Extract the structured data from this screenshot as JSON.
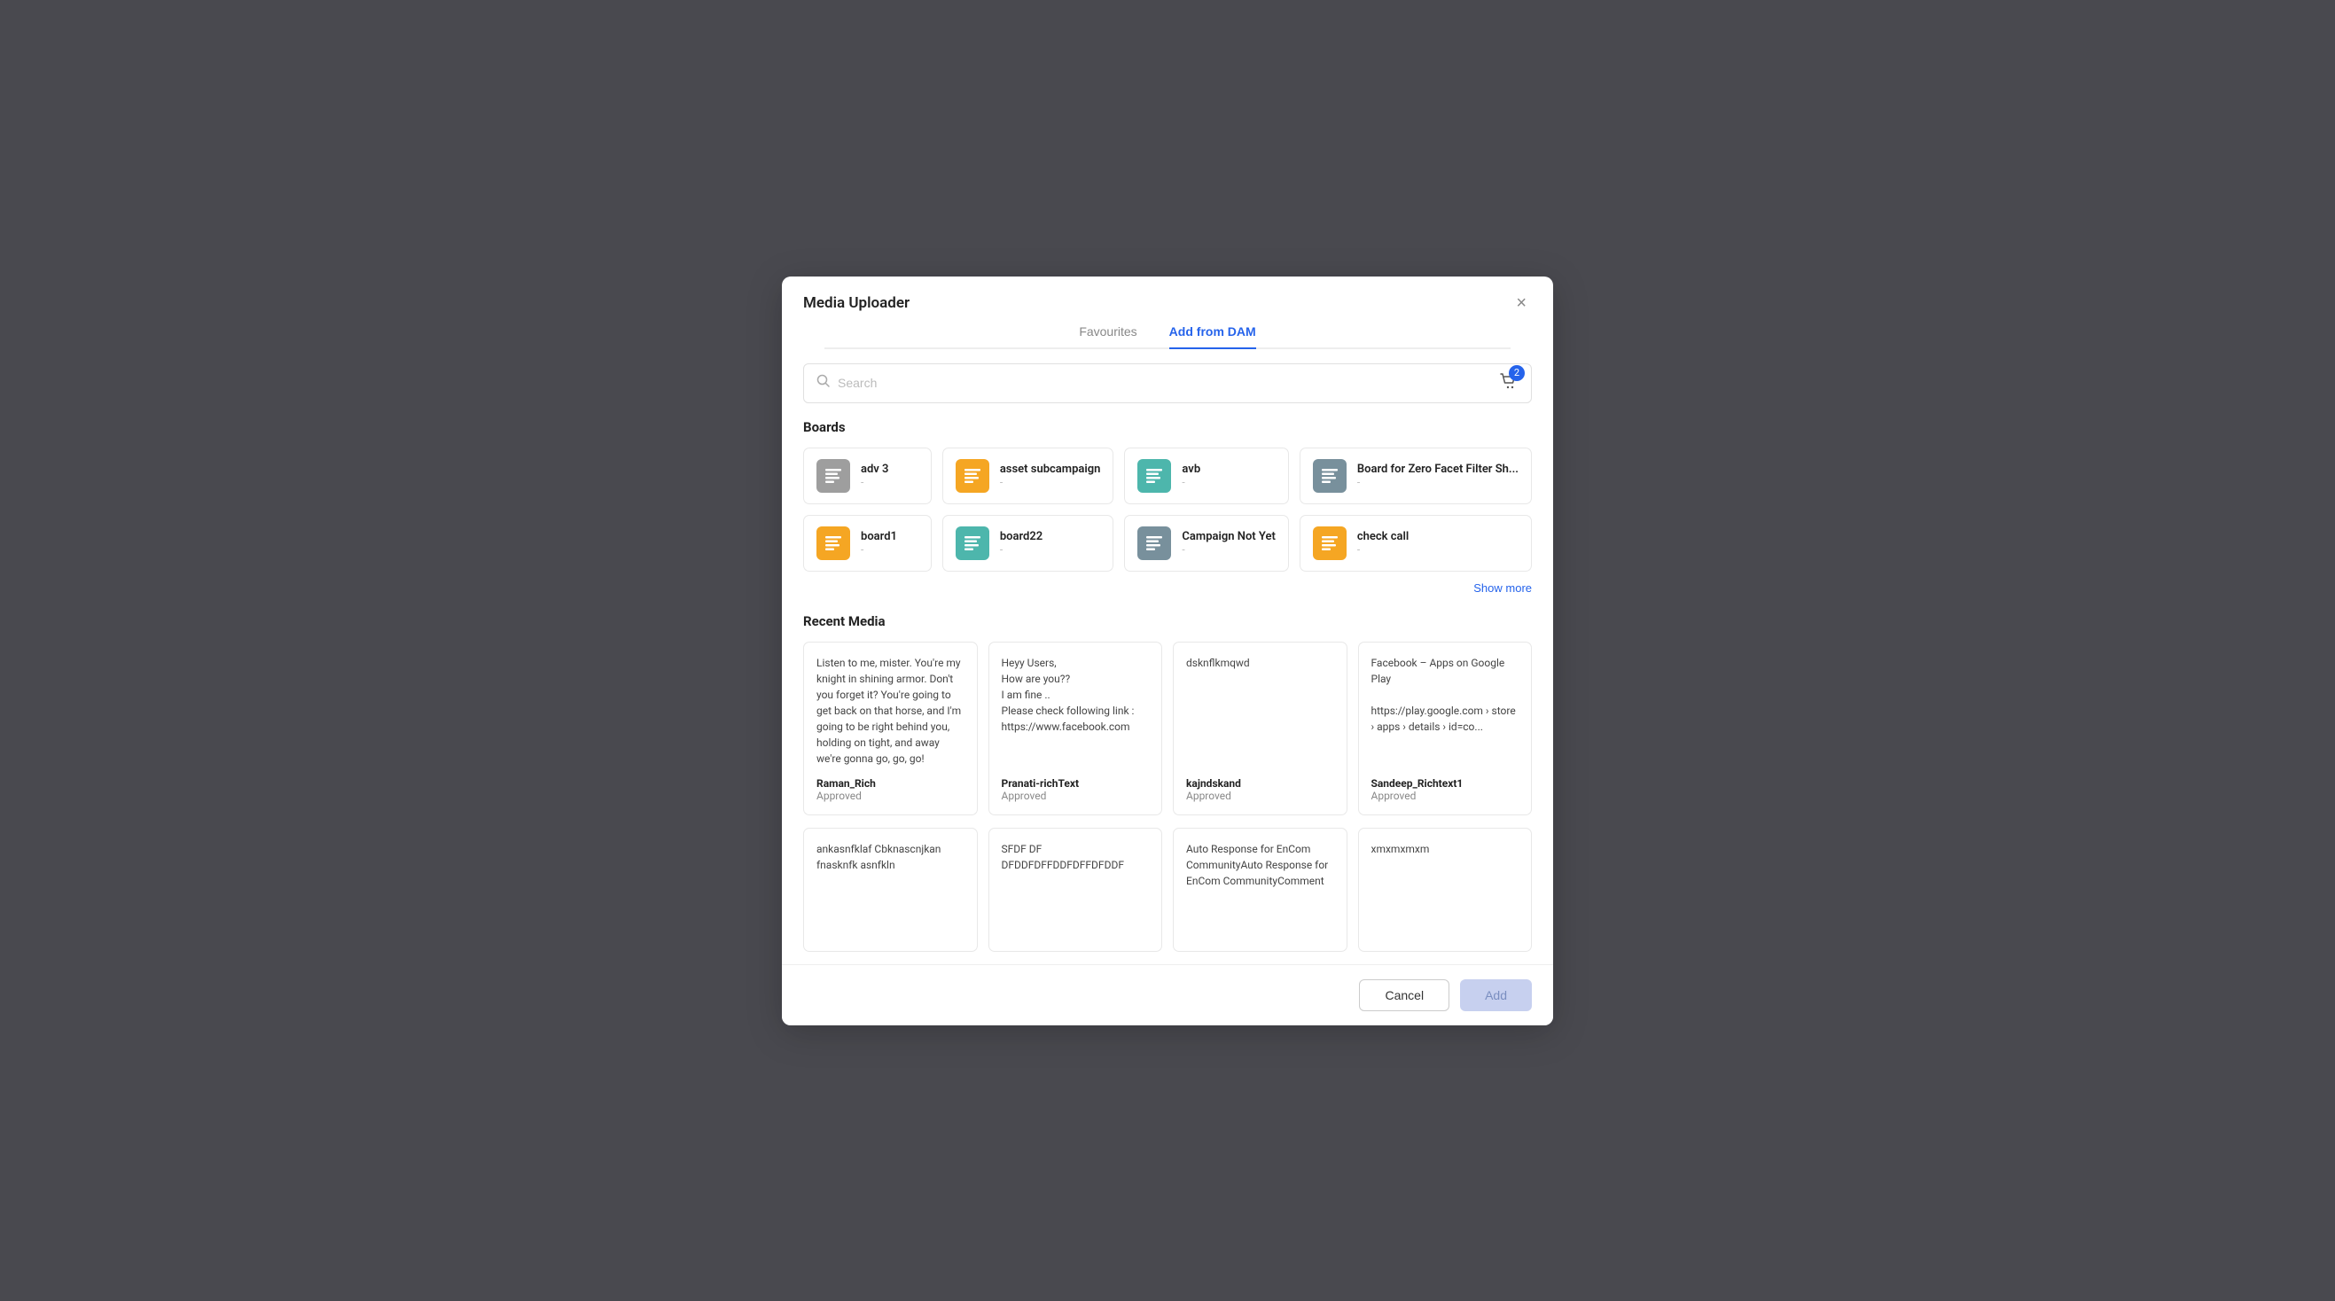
{
  "modal": {
    "title": "Media Uploader",
    "close_label": "×",
    "tabs": [
      {
        "id": "favourites",
        "label": "Favourites",
        "active": false
      },
      {
        "id": "add-from-dam",
        "label": "Add from DAM",
        "active": true
      }
    ],
    "search": {
      "placeholder": "Search"
    },
    "cart_badge": "2",
    "boards_title": "Boards",
    "boards": [
      {
        "id": "adv3",
        "name": "adv 3",
        "sub": "-",
        "color": "gray"
      },
      {
        "id": "asset-subcampaign",
        "name": "asset subcampaign",
        "sub": "-",
        "color": "yellow"
      },
      {
        "id": "avb",
        "name": "avb",
        "sub": "-",
        "color": "teal"
      },
      {
        "id": "board-zero",
        "name": "Board for Zero Facet Filter Sh...",
        "sub": "-",
        "color": "dark"
      },
      {
        "id": "board1",
        "name": "board1",
        "sub": "-",
        "color": "yellow"
      },
      {
        "id": "board22",
        "name": "board22",
        "sub": "-",
        "color": "teal"
      },
      {
        "id": "campaign-not-yet",
        "name": "Campaign Not Yet",
        "sub": "-",
        "color": "dark"
      },
      {
        "id": "check-call",
        "name": "check call",
        "sub": "-",
        "color": "yellow"
      }
    ],
    "show_more_label": "Show more",
    "recent_media_title": "Recent Media",
    "recent_media": [
      {
        "id": "rm1",
        "text": "Listen to me, mister. You're my knight in shining armor. Don't you forget it? You're going to get back on that horse, and I'm going to be right behind you, holding on tight, and away we're gonna go, go, go!",
        "name": "Raman_Rich",
        "status": "Approved"
      },
      {
        "id": "rm2",
        "text": "Heyy Users,\nHow are you??\nI am fine ..\nPlease check following link :\nhttps://www.facebook.com",
        "name": "Pranati-richText",
        "status": "Approved"
      },
      {
        "id": "rm3",
        "text": "dsknflkmqwd",
        "name": "kajndskand",
        "status": "Approved"
      },
      {
        "id": "rm4",
        "text": "Facebook – Apps on Google Play\n\nhttps://play.google.com › store › apps › details › id=co...",
        "name": "Sandeep_Richtext1",
        "status": "Approved"
      }
    ],
    "recent_media_row2": [
      {
        "id": "rm5",
        "text": "ankasnfklaf Cbknascnjkan fnasknfk asnfkln",
        "name": "",
        "status": ""
      },
      {
        "id": "rm6",
        "text": "SFDF DF DFDDFDFFDDFDFFDFDDF",
        "name": "",
        "status": ""
      },
      {
        "id": "rm7",
        "text": "Auto Response for EnCom CommunityAuto Response for EnCom CommunityComment",
        "name": "",
        "status": ""
      },
      {
        "id": "rm8",
        "text": "xmxmxmxm",
        "name": "",
        "status": ""
      }
    ],
    "footer": {
      "cancel_label": "Cancel",
      "add_label": "Add"
    }
  }
}
